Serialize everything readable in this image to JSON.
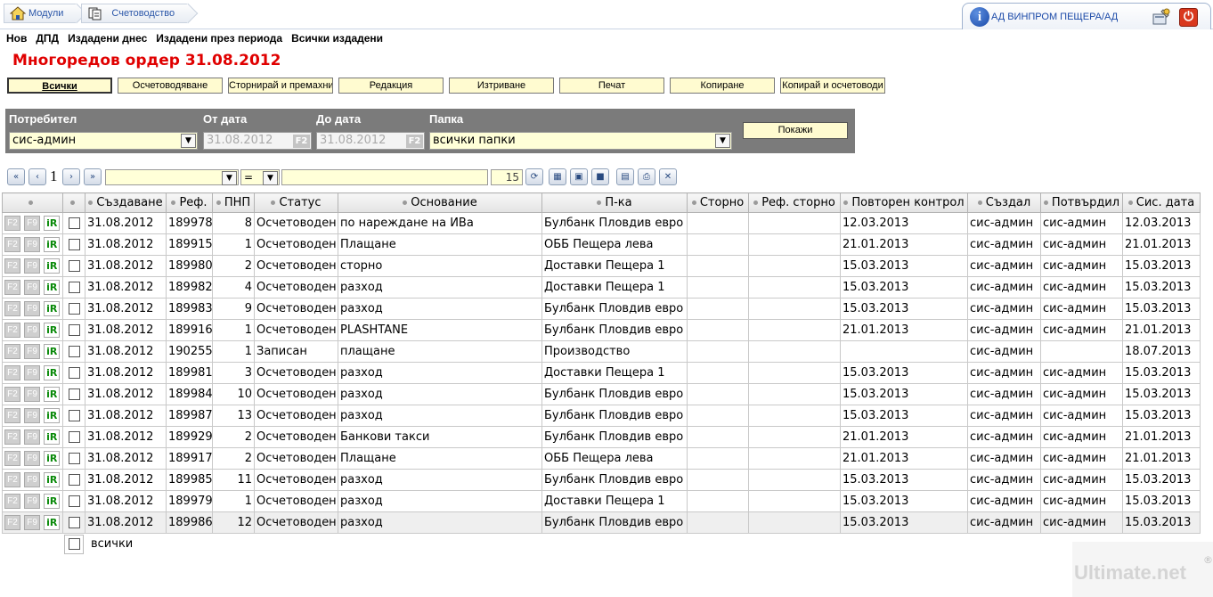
{
  "breadcrumb": {
    "modules": "Модули",
    "section": "Счетоводство"
  },
  "company": "АД ВИНПРОМ ПЕЩЕРА/АД",
  "menu": [
    "Нов",
    "ДПД",
    "Издадени днес",
    "Издадени през периода",
    "Всички издадени"
  ],
  "title": "Многоредов ордер  31.08.2012",
  "actions": [
    "Всички",
    "Осчетоводяване",
    "Сторнирай и премахни",
    "Редакция",
    "Изтриване",
    "Печат",
    "Копиране",
    "Копирай и осчетоводи"
  ],
  "filter": {
    "user_label": "Потребител",
    "user_value": "сис-админ",
    "from_label": "От дата",
    "from_value": "31.08.2012",
    "to_label": "До дата",
    "to_value": "31.08.2012",
    "folder_label": "Папка",
    "folder_value": "всички папки",
    "show_label": "Покажи",
    "f2": "F2"
  },
  "pager": {
    "page": "1",
    "operator": "=",
    "count": "15"
  },
  "columns": [
    "Създаване",
    "Реф.",
    "ПНП",
    "Статус",
    "Основание",
    "П-ка",
    "Сторно",
    "Реф. сторно",
    "Повторен контрол",
    "Създал",
    "Потвърдил",
    "Сис. дата"
  ],
  "row_buttons": {
    "f2": "F2",
    "f9": "F9",
    "ir": "iR"
  },
  "rows": [
    [
      "31.08.2012",
      "189978",
      "8",
      "Осчетоводен",
      "по нареждане на ИВа",
      "Булбанк Пловдив евро",
      "",
      "",
      "12.03.2013",
      "сис-админ",
      "сис-админ",
      "12.03.2013"
    ],
    [
      "31.08.2012",
      "189915",
      "1",
      "Осчетоводен",
      "Плащане",
      "ОББ Пещера лева",
      "",
      "",
      "21.01.2013",
      "сис-админ",
      "сис-админ",
      "21.01.2013"
    ],
    [
      "31.08.2012",
      "189980",
      "2",
      "Осчетоводен",
      "сторно",
      "Доставки Пещера 1",
      "",
      "",
      "15.03.2013",
      "сис-админ",
      "сис-админ",
      "15.03.2013"
    ],
    [
      "31.08.2012",
      "189982",
      "4",
      "Осчетоводен",
      "разход",
      "Доставки Пещера 1",
      "",
      "",
      "15.03.2013",
      "сис-админ",
      "сис-админ",
      "15.03.2013"
    ],
    [
      "31.08.2012",
      "189983",
      "9",
      "Осчетоводен",
      "разход",
      "Булбанк Пловдив евро",
      "",
      "",
      "15.03.2013",
      "сис-админ",
      "сис-админ",
      "15.03.2013"
    ],
    [
      "31.08.2012",
      "189916",
      "1",
      "Осчетоводен",
      "PLASHTANE",
      "Булбанк Пловдив евро",
      "",
      "",
      "21.01.2013",
      "сис-админ",
      "сис-админ",
      "21.01.2013"
    ],
    [
      "31.08.2012",
      "190255",
      "1",
      "Записан",
      "плащане",
      "Производство",
      "",
      "",
      "",
      "сис-админ",
      "",
      "18.07.2013"
    ],
    [
      "31.08.2012",
      "189981",
      "3",
      "Осчетоводен",
      "разход",
      "Доставки Пещера 1",
      "",
      "",
      "15.03.2013",
      "сис-админ",
      "сис-админ",
      "15.03.2013"
    ],
    [
      "31.08.2012",
      "189984",
      "10",
      "Осчетоводен",
      "разход",
      "Булбанк Пловдив евро",
      "",
      "",
      "15.03.2013",
      "сис-админ",
      "сис-админ",
      "15.03.2013"
    ],
    [
      "31.08.2012",
      "189987",
      "13",
      "Осчетоводен",
      "разход",
      "Булбанк Пловдив евро",
      "",
      "",
      "15.03.2013",
      "сис-админ",
      "сис-админ",
      "15.03.2013"
    ],
    [
      "31.08.2012",
      "189929",
      "2",
      "Осчетоводен",
      "Банкови  такси",
      "Булбанк Пловдив евро",
      "",
      "",
      "21.01.2013",
      "сис-админ",
      "сис-админ",
      "21.01.2013"
    ],
    [
      "31.08.2012",
      "189917",
      "2",
      "Осчетоводен",
      "Плащане",
      "ОББ Пещера лева",
      "",
      "",
      "21.01.2013",
      "сис-админ",
      "сис-админ",
      "21.01.2013"
    ],
    [
      "31.08.2012",
      "189985",
      "11",
      "Осчетоводен",
      "разход",
      "Булбанк Пловдив евро",
      "",
      "",
      "15.03.2013",
      "сис-админ",
      "сис-админ",
      "15.03.2013"
    ],
    [
      "31.08.2012",
      "189979",
      "1",
      "Осчетоводен",
      "разход",
      "Доставки Пещера 1",
      "",
      "",
      "15.03.2013",
      "сис-админ",
      "сис-админ",
      "15.03.2013"
    ],
    [
      "31.08.2012",
      "189986",
      "12",
      "Осчетоводен",
      "разход",
      "Булбанк Пловдив евро",
      "",
      "",
      "15.03.2013",
      "сис-админ",
      "сис-админ",
      "15.03.2013"
    ]
  ],
  "select_all_label": "всички",
  "watermark": {
    "text": "Ultimate.net",
    "mark": "®"
  }
}
